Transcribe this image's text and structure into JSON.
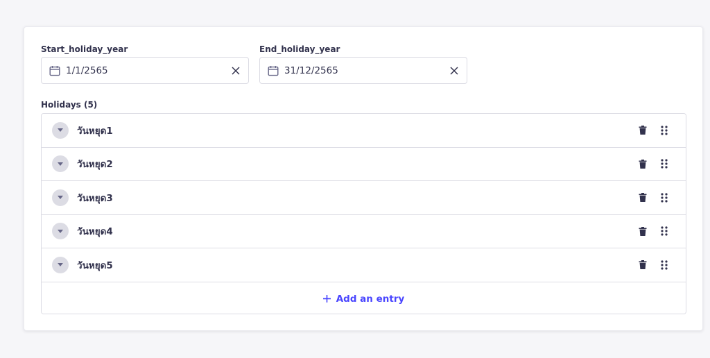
{
  "start_field": {
    "label": "Start_holiday_year",
    "value": "1/1/2565"
  },
  "end_field": {
    "label": "End_holiday_year",
    "value": "31/12/2565"
  },
  "holidays": {
    "label": "Holidays (5)",
    "items": [
      {
        "label": "วันหยุด1"
      },
      {
        "label": "วันหยุด2"
      },
      {
        "label": "วันหยุด3"
      },
      {
        "label": "วันหยุด4"
      },
      {
        "label": "วันหยุด5"
      }
    ],
    "add_label": "Add an entry"
  },
  "colors": {
    "accent": "#4945ff",
    "text": "#32324d",
    "border": "#dcdce4",
    "background": "#f6f6f9"
  },
  "icons": {
    "date": "calendar-icon",
    "clear": "close-icon",
    "toggle": "caret-down-icon",
    "delete": "trash-icon",
    "reorder": "drag-handle-icon",
    "add": "plus-icon"
  }
}
